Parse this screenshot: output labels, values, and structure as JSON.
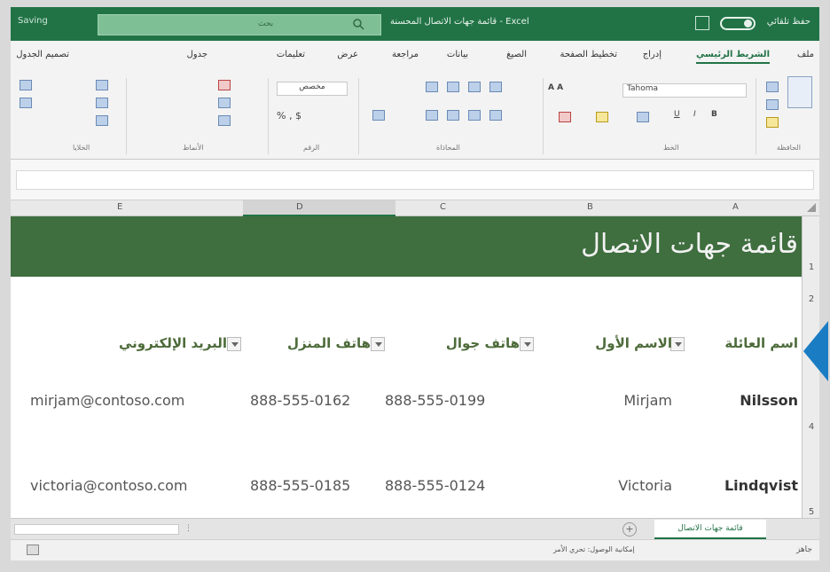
{
  "titlebar": {
    "save_label": "Saving",
    "search_placeholder": "بحث",
    "doc_title": "Excel - قائمة جهات الاتصال المحسنة",
    "autosave_label": "حفظ تلقائي"
  },
  "ribbon": {
    "tabs": [
      "ملف",
      "الشريط الرئيسي",
      "إدراج",
      "تخطيط الصفحة",
      "الصيغ",
      "بيانات",
      "مراجعة",
      "عرض",
      "تعليمات",
      "جدول",
      "تصميم الجدول"
    ],
    "active_tab": "الشريط الرئيسي",
    "font_name": "Tahoma",
    "number_format": "مخصص",
    "groups": [
      "الحافظة",
      "الخط",
      "المحاذاة",
      "الرقم",
      "الأنماط",
      "الخلايا"
    ]
  },
  "sheet": {
    "columns": [
      "A",
      "B",
      "C",
      "D",
      "E"
    ],
    "title": "قائمة جهات الاتصال",
    "headers": {
      "last_name": "اسم العائلة",
      "first_name": "الاسم الأول",
      "mobile": "هاتف جوال",
      "home": "هاتف المنزل",
      "email": "البريد الإلكتروني"
    },
    "rows": [
      {
        "last_name": "Nilsson",
        "first_name": "Mirjam",
        "mobile": "888-555-0199",
        "home": "888-555-0162",
        "email": "mirjam@contoso.com"
      },
      {
        "last_name": "Lindqvist",
        "first_name": "Victoria",
        "mobile": "888-555-0124",
        "home": "888-555-0185",
        "email": "victoria@contoso.com"
      }
    ],
    "row_numbers": [
      "1",
      "2",
      "4",
      "5"
    ]
  },
  "tabbar": {
    "sheet_tab": "قائمة جهات الاتصال",
    "add_label": "+"
  },
  "statusbar": {
    "text": "إمكانية الوصول: تحري الأمر",
    "ready": "جاهز"
  },
  "colors": {
    "excel_green": "#217346",
    "banner_green": "#3f6e3f",
    "header_text": "#4d6b3a",
    "arrow_blue": "#1a7dc4"
  }
}
